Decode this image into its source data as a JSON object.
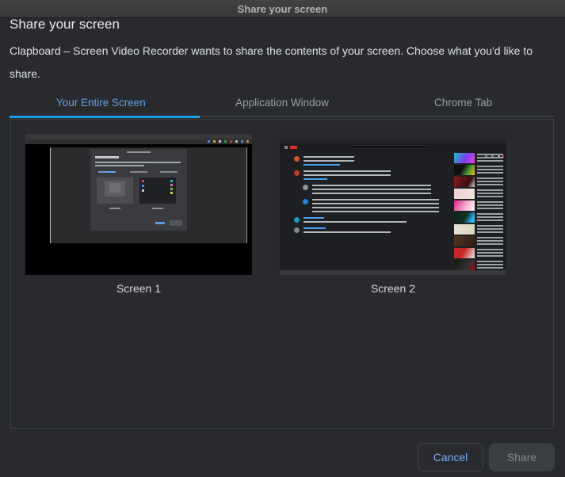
{
  "window": {
    "title": "Share your screen"
  },
  "dialog": {
    "heading": "Share your screen",
    "description": "Clapboard – Screen Video Recorder wants to share the contents of your screen. Choose what you'd like to share.",
    "tabs": [
      {
        "label": "Your Entire Screen",
        "active": true
      },
      {
        "label": "Application Window",
        "active": false
      },
      {
        "label": "Chrome Tab",
        "active": false
      }
    ],
    "screens": [
      {
        "label": "Screen 1"
      },
      {
        "label": "Screen 2"
      }
    ],
    "buttons": {
      "cancel": "Cancel",
      "share": "Share",
      "share_enabled": false
    }
  },
  "colors": {
    "dialog_background": "#292a2d",
    "active_tab_text": "#68a2e4",
    "active_tab_underline": "#1b9fe9",
    "inactive_tab_text": "#9aa0a6",
    "cancel_text": "#7daaf7",
    "share_disabled_bg": "#3b3e42",
    "share_disabled_text": "#85888d"
  }
}
